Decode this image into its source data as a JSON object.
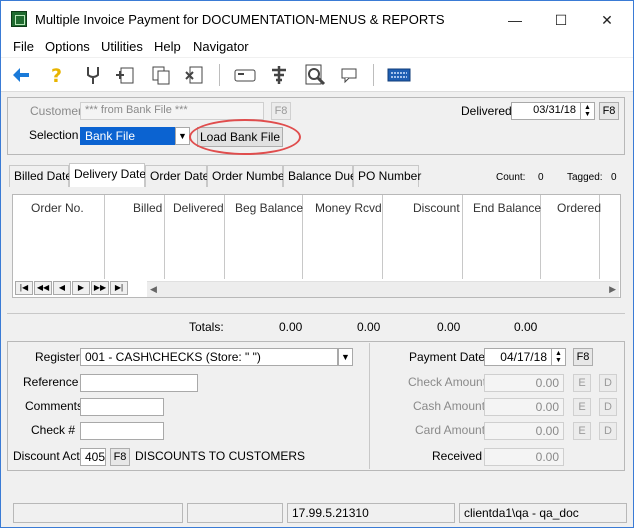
{
  "window": {
    "title": "Multiple Invoice Payment for DOCUMENTATION-MENUS & REPORTS",
    "minimize_glyph": "—",
    "maximize_glyph": "☐",
    "close_glyph": "✕"
  },
  "menu": [
    "File",
    "Options",
    "Utilities",
    "Help",
    "Navigator"
  ],
  "toolbar": {
    "icons": [
      "back-arrow-icon",
      "help-question-icon",
      "tuning-fork-icon",
      "add-page-icon",
      "copy-pages-icon",
      "delete-page-icon",
      "card-icon",
      "tree-icon",
      "magnifier-icon",
      "chat-icon",
      "keyboard-icon"
    ]
  },
  "top": {
    "customer_label": "Customer",
    "customer_value": "*** from Bank File ***",
    "f8": "F8",
    "selection_label": "Selection",
    "selection_value": "Bank File",
    "load_button": "Load Bank File",
    "delivered_label": "Delivered",
    "delivered_value": "03/31/18"
  },
  "tabs": [
    "Billed Date",
    "Delivery Date",
    "Order Date",
    "Order Number",
    "Balance Due",
    "PO Number"
  ],
  "active_tab": "Delivery Date",
  "counts": {
    "count_label": "Count:",
    "count_value": "0",
    "tagged_label": "Tagged:",
    "tagged_value": "0"
  },
  "grid": {
    "columns": [
      "Order No.",
      "Billed",
      "Delivered",
      "Beg Balance",
      "Money Rcvd",
      "Discount",
      "End Balance",
      "Ordered"
    ],
    "nav": [
      "|◀",
      "◀◀",
      "◀",
      "▶",
      "▶▶",
      "▶|"
    ]
  },
  "totals": {
    "label": "Totals:",
    "values": [
      "0.00",
      "0.00",
      "0.00",
      "0.00"
    ]
  },
  "bottom": {
    "register_label": "Register",
    "register_value": "001 - CASH\\CHECKS (Store: \" \")",
    "reference_label": "Reference",
    "reference_value": "",
    "comments_label": "Comments",
    "comments_value": "",
    "check_label": "Check #",
    "check_value": "",
    "discount_label": "Discount Act",
    "discount_code": "405",
    "discount_desc": "DISCOUNTS TO CUSTOMERS",
    "payment_date_label": "Payment Date",
    "payment_date_value": "04/17/18",
    "check_amount_label": "Check Amount",
    "check_amount_value": "0.00",
    "cash_amount_label": "Cash Amount",
    "cash_amount_value": "0.00",
    "card_amount_label": "Card Amount",
    "card_amount_value": "0.00",
    "received_label": "Received",
    "received_value": "0.00",
    "e": "E",
    "d": "D"
  },
  "status": {
    "version": "17.99.5.21310",
    "client": "clientda1\\qa - qa_doc"
  },
  "colors": {
    "accent": "#0b63d1",
    "highlight_ring": "#e04d4d"
  }
}
